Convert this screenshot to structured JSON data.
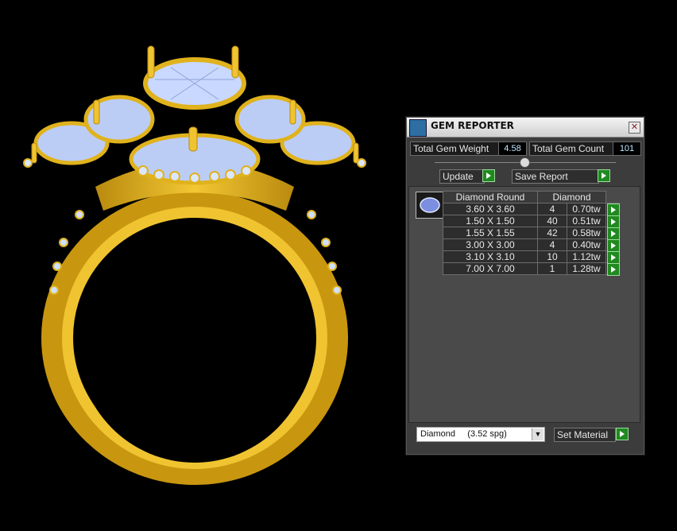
{
  "panel": {
    "title": "GEM REPORTER",
    "close_glyph": "✕",
    "total_gem_weight_label": "Total Gem Weight",
    "total_gem_weight_value": "4.58",
    "total_gem_count_label": "Total Gem Count",
    "total_gem_count_value": "101",
    "update_label": "Update",
    "save_report_label": "Save Report",
    "table": {
      "headers": [
        "Diamond Round",
        "Diamond"
      ],
      "rows": [
        {
          "size": "3.60 X 3.60",
          "count": "4",
          "weight": "0.70tw"
        },
        {
          "size": "1.50 X 1.50",
          "count": "40",
          "weight": "0.51tw"
        },
        {
          "size": "1.55 X 1.55",
          "count": "42",
          "weight": "0.58tw"
        },
        {
          "size": "3.00 X 3.00",
          "count": "4",
          "weight": "0.40tw"
        },
        {
          "size": "3.10 X 3.10",
          "count": "10",
          "weight": "1.12tw"
        },
        {
          "size": "7.00 X 7.00",
          "count": "1",
          "weight": "1.28tw"
        }
      ]
    },
    "material_value": "Diamond     (3.52 spg)",
    "set_material_label": "Set Material"
  },
  "icons": [
    "gem-reporter-icon",
    "close-icon",
    "play-arrow-icon",
    "gem-thumbnail-icon",
    "dropdown-arrow-icon"
  ],
  "colors": {
    "gold": "#e0b21c",
    "gem": "#c8d8ff",
    "background": "#000000",
    "panel": "#3c3c3c",
    "go_button": "#1f8a1f"
  }
}
